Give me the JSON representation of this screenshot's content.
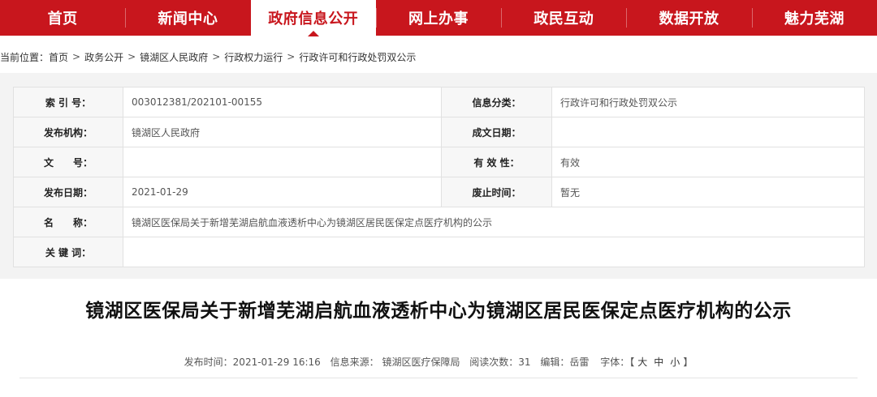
{
  "nav": {
    "items": [
      "首页",
      "新闻中心",
      "政府信息公开",
      "网上办事",
      "政民互动",
      "数据开放",
      "魅力芜湖"
    ],
    "active_index": 2,
    "color": "#c8161d"
  },
  "breadcrumb": {
    "prefix": "当前位置：",
    "items": [
      "首页",
      "政务公开",
      "镜湖区人民政府",
      "行政权力运行",
      "行政许可和行政处罚双公示"
    ],
    "separator": ">"
  },
  "meta": {
    "index_label": "索 引 号：",
    "index_value": "003012381/202101-00155",
    "category_label": "信息分类：",
    "category_value": "行政许可和行政处罚双公示",
    "publisher_label": "发布机构：",
    "publisher_value": "镜湖区人民政府",
    "written_date_label": "成文日期：",
    "written_date_value": "",
    "doc_no_label": "文　　号：",
    "doc_no_value": "",
    "validity_label": "有 效 性：",
    "validity_value": "有效",
    "pub_date_label": "发布日期：",
    "pub_date_value": "2021-01-29",
    "abolish_label": "废止时间：",
    "abolish_value": "暂无",
    "name_label": "名　　称：",
    "name_value": "镜湖区医保局关于新增芜湖启航血液透析中心为镜湖区居民医保定点医疗机构的公示",
    "keywords_label": "关 键 词：",
    "keywords_value": ""
  },
  "article": {
    "title": "镜湖区医保局关于新增芜湖启航血液透析中心为镜湖区居民医保定点医疗机构的公示",
    "publish_time": "发布时间：2021-01-29 16:16",
    "source": "信息来源：  镜湖区医疗保障局",
    "views": "阅读次数：31",
    "editor": "编辑：岳雷",
    "font_size_prefix": "字体：【",
    "font_large": "大",
    "font_medium": "中",
    "font_small": "小",
    "font_size_suffix": "】"
  }
}
